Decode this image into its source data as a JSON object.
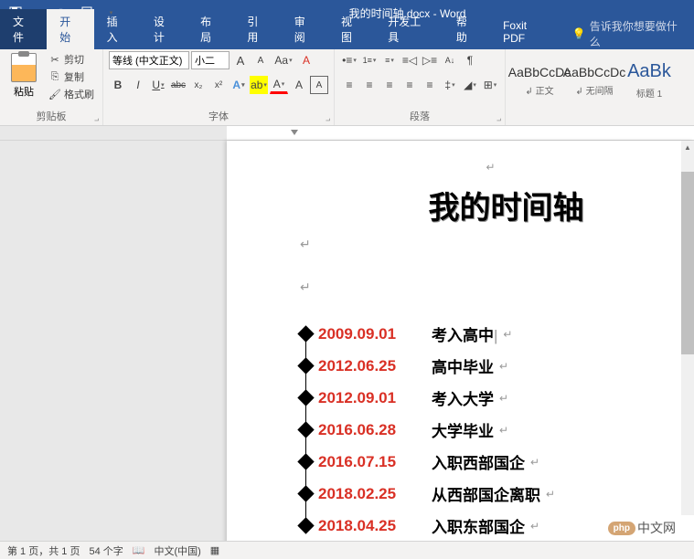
{
  "title": "我的时间轴.docx - Word",
  "qat": {
    "save": "💾",
    "undo": "↶",
    "redo": "↻",
    "new": "📄"
  },
  "tabs": {
    "file": "文件",
    "items": [
      "开始",
      "插入",
      "设计",
      "布局",
      "引用",
      "审阅",
      "视图",
      "开发工具",
      "帮助",
      "Foxit PDF"
    ],
    "active": 0,
    "tellme": "告诉我你想要做什么"
  },
  "ribbon": {
    "clipboard": {
      "label": "剪贴板",
      "paste": "粘贴",
      "cut": "剪切",
      "copy": "复制",
      "painter": "格式刷"
    },
    "font": {
      "label": "字体",
      "name": "等线 (中文正文)",
      "size": "小二",
      "grow": "A",
      "shrink": "A",
      "case": "Aa",
      "clear": "A",
      "bold": "B",
      "italic": "I",
      "underline": "U",
      "strike": "abc",
      "sub": "x₂",
      "sup": "x²",
      "effects": "A",
      "highlight": "A",
      "color": "A",
      "phonetic": "A",
      "border": "A"
    },
    "paragraph": {
      "label": "段落",
      "bullets": "⋮≡",
      "numbering": "1≡",
      "multilevel": "≡",
      "dedent": "⇤",
      "indent": "⇥",
      "sort": "A↓",
      "marks": "¶",
      "left": "≡",
      "center": "≡",
      "right": "≡",
      "justify": "≡",
      "distribute": "≡",
      "spacing": "‡",
      "shading": "▦",
      "borders": "⊞"
    },
    "styles": [
      {
        "preview": "AaBbCcDc",
        "name": "↲ 正文"
      },
      {
        "preview": "AaBbCcDc",
        "name": "↲ 无间隔"
      },
      {
        "preview": "AaBk",
        "name": "标题 1",
        "big": true
      }
    ]
  },
  "document": {
    "title": "我的时间轴",
    "timeline": [
      {
        "date": "2009.09.01",
        "event": "考入高中"
      },
      {
        "date": "2012.06.25",
        "event": "高中毕业"
      },
      {
        "date": "2012.09.01",
        "event": "考入大学"
      },
      {
        "date": "2016.06.28",
        "event": "大学毕业"
      },
      {
        "date": "2016.07.15",
        "event": "入职西部国企"
      },
      {
        "date": "2018.02.25",
        "event": "从西部国企离职"
      },
      {
        "date": "2018.04.25",
        "event": "入职东部国企"
      }
    ]
  },
  "statusbar": {
    "page": "第 1 页，共 1 页",
    "words": "54 个字",
    "lang": "中文(中国)"
  },
  "watermark": {
    "badge": "php",
    "text": "中文网"
  }
}
